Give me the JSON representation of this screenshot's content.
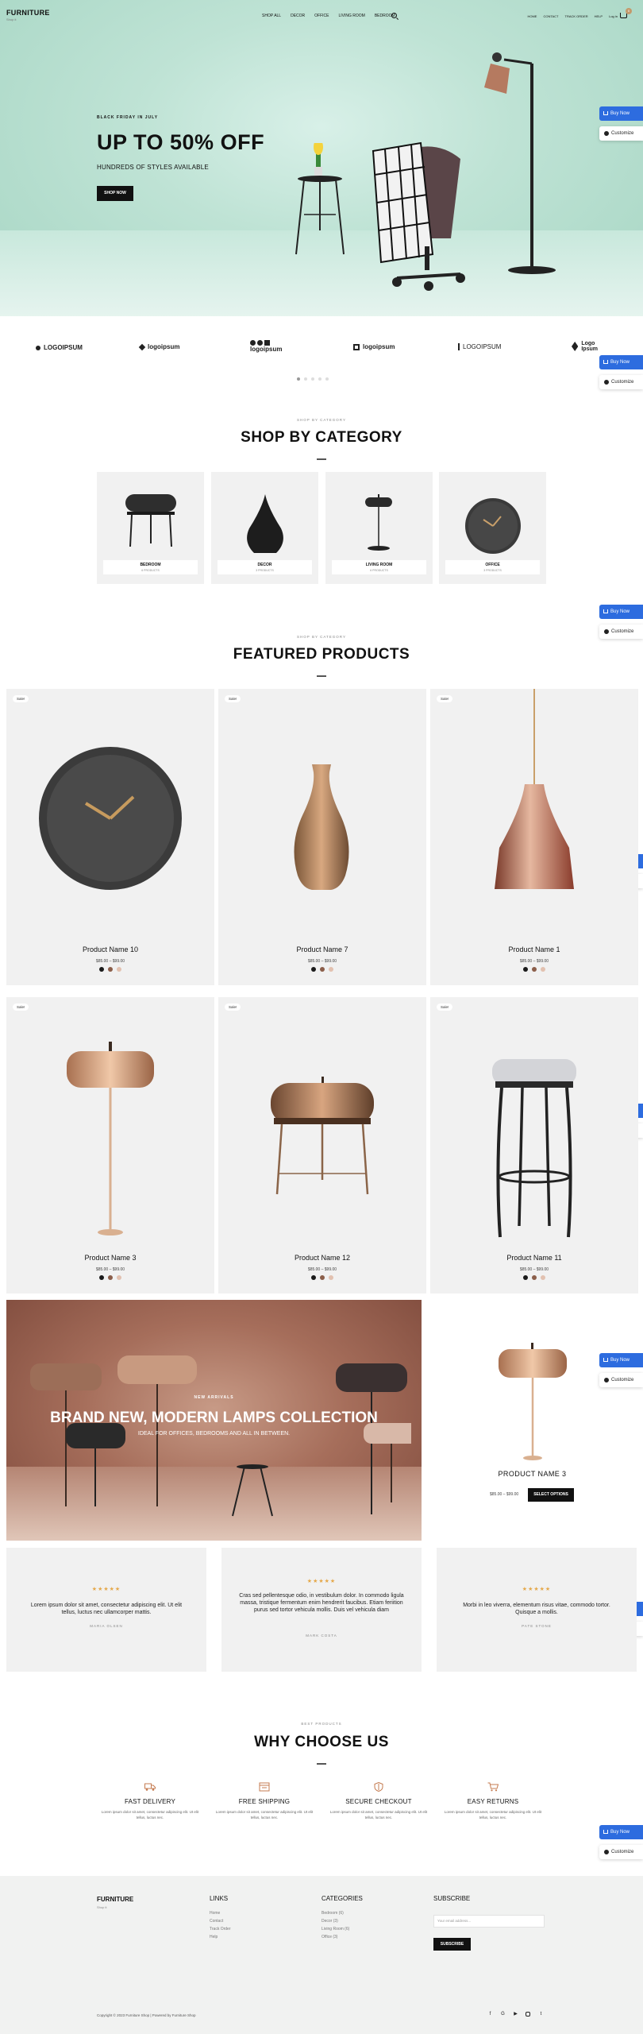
{
  "header": {
    "brand": "FURNITURE",
    "tagline": "Shop it",
    "nav": [
      "SHOP ALL",
      "DECOR",
      "OFFICE",
      "LIVING ROOM",
      "BEDROOM"
    ],
    "utility": [
      "HOME",
      "CONTACT",
      "TRACK ORDER",
      "HELP",
      "Log in"
    ],
    "cart_count": "0"
  },
  "hero": {
    "kicker": "BLACK FRIDAY IN JULY",
    "title": "UP TO 50% OFF",
    "subtitle": "HUNDREDS OF STYLES AVAILABLE",
    "button": "SHOP NOW"
  },
  "floating": {
    "buy_now": "Buy Now",
    "customize": "Customize"
  },
  "partner_logos": [
    "LOGOIPSUM",
    "logoipsum",
    "logoipsum",
    "logoipsum",
    "LOGOIPSUM",
    "Logo Ipsum"
  ],
  "categories_section": {
    "kicker": "SHOP BY CATEGORY",
    "title": "SHOP BY CATEGORY",
    "items": [
      {
        "name": "BEDROOM",
        "count": "6 PRODUCTS"
      },
      {
        "name": "DECOR",
        "count": "3 PRODUCTS"
      },
      {
        "name": "LIVING ROOM",
        "count": "6 PRODUCTS"
      },
      {
        "name": "OFFICE",
        "count": "3 PRODUCTS"
      }
    ]
  },
  "featured_section": {
    "kicker": "SHOP BY CATEGORY",
    "title": "FEATURED PRODUCTS",
    "sale_badge": "Sale!",
    "products": [
      {
        "name": "Product Name 10",
        "price": "$85.00 – $99.00"
      },
      {
        "name": "Product Name 7",
        "price": "$85.00 – $99.00"
      },
      {
        "name": "Product Name 1",
        "price": "$85.00 – $99.00"
      },
      {
        "name": "Product Name 3",
        "price": "$85.00 – $99.00"
      },
      {
        "name": "Product Name 12",
        "price": "$85.00 – $99.00"
      },
      {
        "name": "Product Name 11",
        "price": "$85.00 – $99.00"
      }
    ],
    "swatch_colors": [
      "#1a1a1a",
      "#8b5e4a",
      "#e2c1b0"
    ]
  },
  "banner": {
    "kicker": "NEW ARRIVALS",
    "title": "BRAND NEW, MODERN LAMPS COLLECTION",
    "subtitle": "IDEAL FOR OFFICES, BEDROOMS AND ALL IN BETWEEN."
  },
  "featured_single": {
    "name": "PRODUCT NAME 3",
    "price": "$85.00 – $99.00",
    "button": "SELECT OPTIONS"
  },
  "testimonials": [
    {
      "stars": "★★★★★",
      "quote": "Lorem ipsum dolor sit amet, consectetur adipiscing elit. Ut elit tellus, luctus nec ullamcorper mattis.",
      "author": "MARIA OLSEN"
    },
    {
      "stars": "★★★★★",
      "quote": "Cras sed pellentesque odio, in vestibulum dolor. In commodo ligula massa, tristique fermentum enim hendrerit faucibus. Etiam feriition purus sed tortor vehicula mollis. Duis vel vehicula diam",
      "author": "MARK COSTA"
    },
    {
      "stars": "★★★★★",
      "quote": "Morbi in leo viverra, elementum risus vitae, commodo tortor. Quisque a mollis.",
      "author": "PATE STONE"
    }
  ],
  "why_section": {
    "kicker": "BEST PRODUCTS",
    "title": "WHY CHOOSE US",
    "items": [
      {
        "icon": "truck-icon",
        "title": "FAST DELIVERY",
        "desc": "Lorem ipsum dolor sit amet, consectetur adipiscing elit. Ut elit tellus, luctus nec."
      },
      {
        "icon": "package-icon",
        "title": "FREE SHIPPING",
        "desc": "Lorem ipsum dolor sit amet, consectetur adipiscing elit. Ut elit tellus, luctus nec."
      },
      {
        "icon": "shield-icon",
        "title": "SECURE CHECKOUT",
        "desc": "Lorem ipsum dolor sit amet, consectetur adipiscing elit. Ut elit tellus, luctus nec."
      },
      {
        "icon": "cart-icon",
        "title": "EASY RETURNS",
        "desc": "Lorem ipsum dolor sit amet, consectetur adipiscing elit. Ut elit tellus, luctus nec."
      }
    ],
    "accent_color": "#c47b50"
  },
  "footer": {
    "brand": "FURNITURE",
    "tagline": "Shop it",
    "links_title": "LINKS",
    "links": [
      "Home",
      "Contact",
      "Track Order",
      "Help"
    ],
    "categories_title": "CATEGORIES",
    "categories": [
      "Bedroom (6)",
      "Decor (3)",
      "Living Room (6)",
      "Office (3)"
    ],
    "subscribe_title": "SUBSCRIBE",
    "email_placeholder": "Your email address...",
    "subscribe_button": "SUBSCRIBE",
    "copyright": "Copyright © 2023 Furniture Shop | Powered by Furniture Shop",
    "social_icons": [
      "facebook-icon",
      "google-icon",
      "youtube-icon",
      "instagram-icon",
      "twitter-icon"
    ]
  }
}
